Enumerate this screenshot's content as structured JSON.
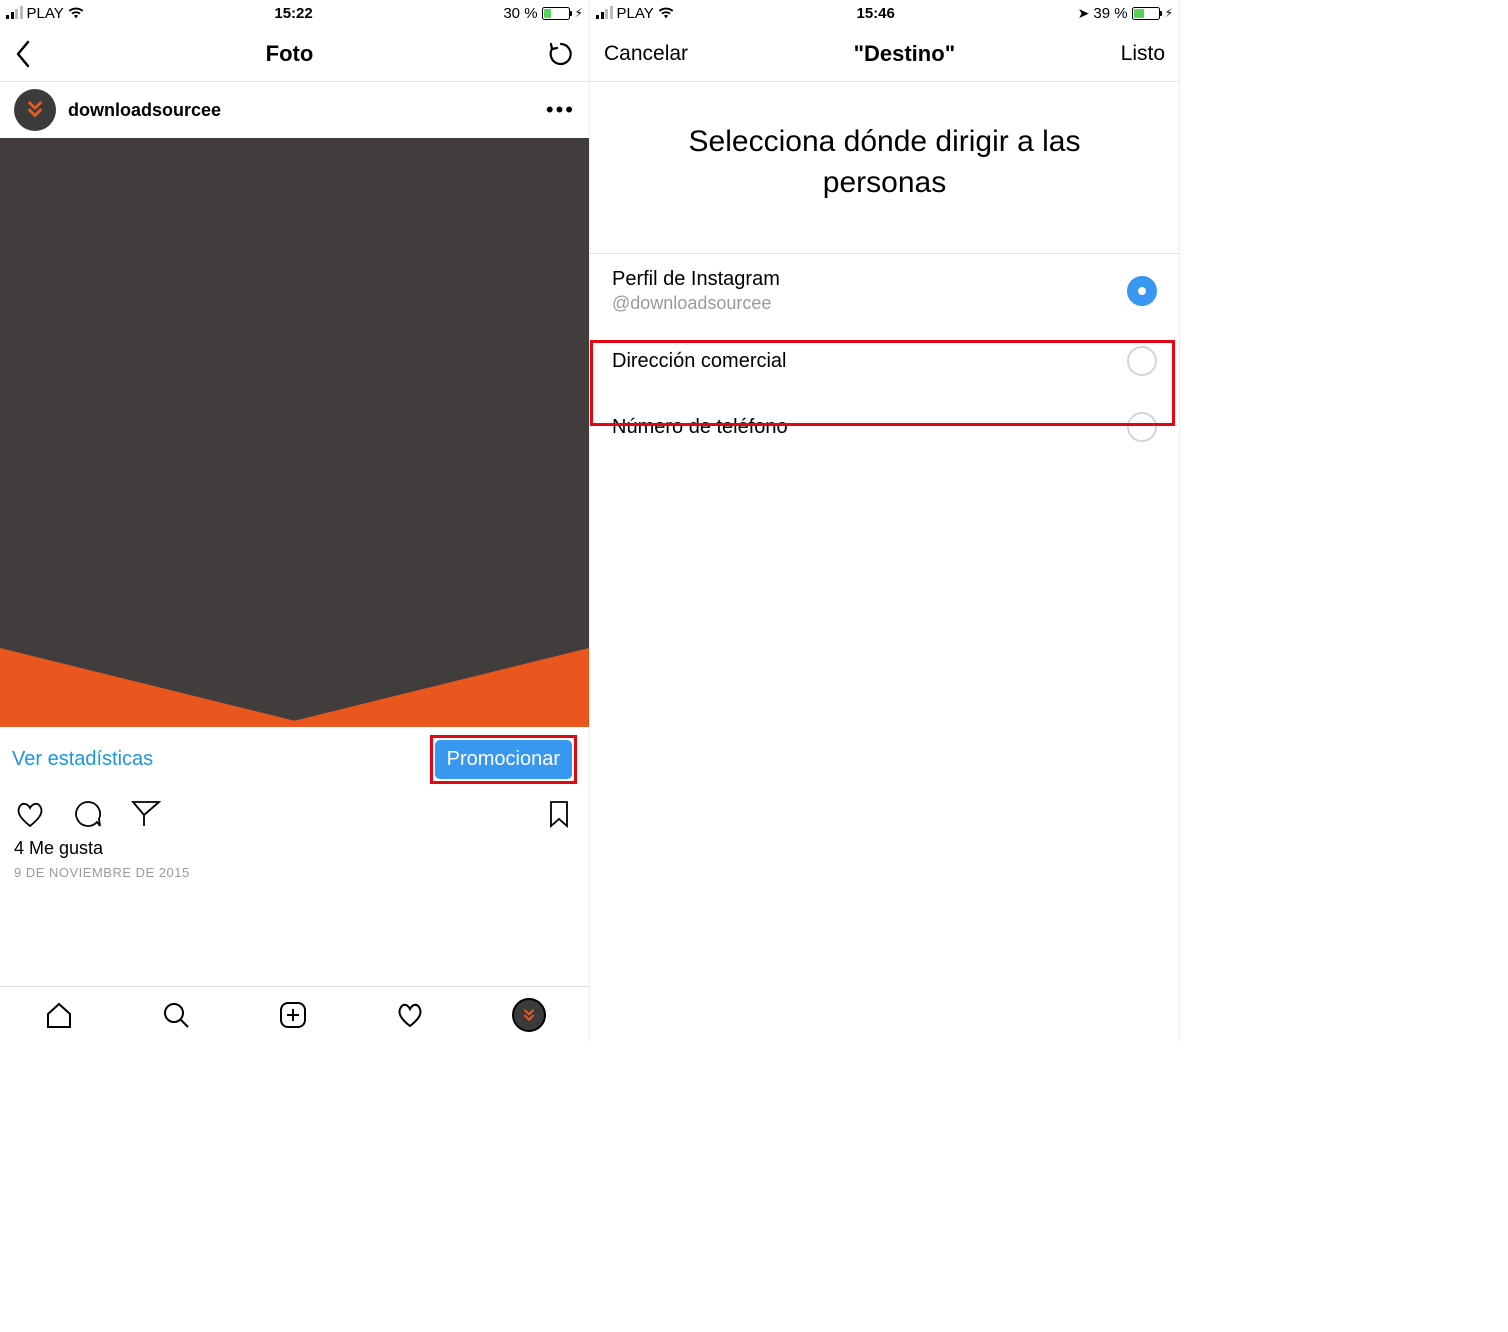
{
  "left": {
    "status": {
      "carrier": "PLAY",
      "time": "15:22",
      "battery_pct": "30 %",
      "battery_fill": 30
    },
    "nav": {
      "title": "Foto"
    },
    "post": {
      "username": "downloadsourcee",
      "stats_link": "Ver estadísticas",
      "promote_label": "Promocionar",
      "likes": "4 Me gusta",
      "date": "9 DE NOVIEMBRE DE 2015"
    }
  },
  "right": {
    "status": {
      "carrier": "PLAY",
      "time": "15:46",
      "battery_pct": "39 %",
      "battery_fill": 39
    },
    "nav": {
      "cancel": "Cancelar",
      "title": "Destino",
      "done": "Listo"
    },
    "heading": "Selecciona dónde dirigir a las personas",
    "options": [
      {
        "title": "Perfil de Instagram",
        "sub": "@downloadsourcee",
        "selected": true
      },
      {
        "title": "Dirección comercial",
        "sub": "",
        "selected": false
      },
      {
        "title": "Número de teléfono",
        "sub": "",
        "selected": false
      }
    ]
  }
}
